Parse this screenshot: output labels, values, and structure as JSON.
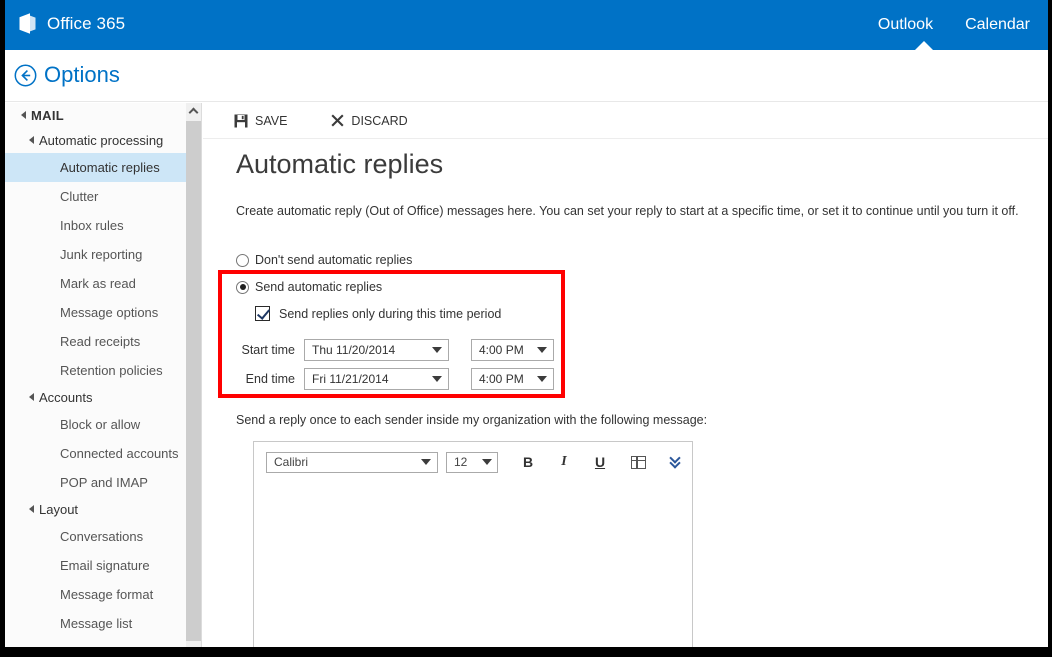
{
  "suite": {
    "brand": "Office 365",
    "logo_icon": "office-tile-icon",
    "links": [
      {
        "label": "Outlook",
        "active": true
      },
      {
        "label": "Calendar",
        "active": false
      }
    ],
    "accent_color": "#0072c6"
  },
  "options_header": {
    "back_icon": "back-arrow-circle-icon",
    "title": "Options",
    "title_color": "#0072c6"
  },
  "sidebar": {
    "scroll_up_icon": "chevron-up-icon",
    "groups": [
      {
        "label": "MAIL",
        "level": 0,
        "expander_icon": "triangle-expanded-icon",
        "items": []
      },
      {
        "label": "Automatic processing",
        "level": 1,
        "expander_icon": "triangle-expanded-icon",
        "items": [
          {
            "label": "Automatic replies",
            "selected": true
          },
          {
            "label": "Clutter",
            "selected": false
          },
          {
            "label": "Inbox rules",
            "selected": false
          },
          {
            "label": "Junk reporting",
            "selected": false
          },
          {
            "label": "Mark as read",
            "selected": false
          },
          {
            "label": "Message options",
            "selected": false
          },
          {
            "label": "Read receipts",
            "selected": false
          },
          {
            "label": "Retention policies",
            "selected": false
          }
        ]
      },
      {
        "label": "Accounts",
        "level": 1,
        "expander_icon": "triangle-expanded-icon",
        "items": [
          {
            "label": "Block or allow",
            "selected": false
          },
          {
            "label": "Connected accounts",
            "selected": false
          },
          {
            "label": "POP and IMAP",
            "selected": false
          }
        ]
      },
      {
        "label": "Layout",
        "level": 1,
        "expander_icon": "triangle-expanded-icon",
        "items": [
          {
            "label": "Conversations",
            "selected": false
          },
          {
            "label": "Email signature",
            "selected": false
          },
          {
            "label": "Message format",
            "selected": false
          },
          {
            "label": "Message list",
            "selected": false
          }
        ]
      }
    ],
    "selected_background": "#cde6f7"
  },
  "toolbar": {
    "save_label": "SAVE",
    "save_icon": "save-floppy-icon",
    "discard_label": "DISCARD",
    "discard_icon": "close-x-icon"
  },
  "main": {
    "page_title": "Automatic replies",
    "description": "Create automatic reply (Out of Office) messages here. You can set your reply to start at a specific time, or set it to continue until you turn it off.",
    "option_off": {
      "label": "Don't send automatic replies",
      "selected": false
    },
    "option_on": {
      "label": "Send automatic replies",
      "selected": true
    },
    "time_period_checkbox": {
      "label": "Send replies only during this time period",
      "checked": true
    },
    "start_time": {
      "label": "Start time",
      "date_value": "Thu 11/20/2014",
      "time_value": "4:00 PM"
    },
    "end_time": {
      "label": "End time",
      "date_value": "Fri 11/21/2014",
      "time_value": "4:00 PM"
    },
    "reply_message_label": "Send a reply once to each sender inside my organization with the following message:",
    "highlight": {
      "color": "#ff0000",
      "note": "red annotation rectangle around automatic reply time period settings"
    }
  },
  "editor": {
    "font_value": "Calibri",
    "size_value": "12",
    "bold_label": "B",
    "italic_label": "I",
    "underline_label": "U",
    "table_icon": "table-grid-icon",
    "more_icon": "double-chevron-down-icon",
    "body_value": ""
  }
}
